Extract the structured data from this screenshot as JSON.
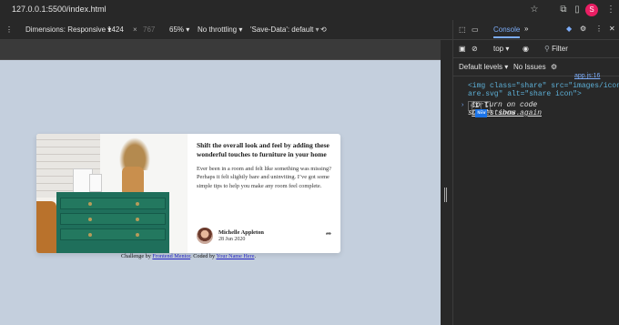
{
  "browser": {
    "url": "127.0.0.1:5500/index.html",
    "avatar_letter": "S"
  },
  "devbar": {
    "dimensions": "Dimensions: Responsive",
    "width": "1424",
    "times": "×",
    "height": "767",
    "zoom": "65%",
    "throttle": "No throttling",
    "save_data": "'Save-Data': default"
  },
  "card": {
    "title": "Shift the overall look and feel by adding these wonderful touches to furniture in your home",
    "description": "Ever been in a room and felt like something was missing? Perhaps it felt slightly bare and uninviting. I’ve got some simple tips to help you make any room feel complete.",
    "author": "Michelle Appleton",
    "date": "28 Jun 2020"
  },
  "attribution": {
    "prefix": "Challenge by",
    "fm": "Frontend Mentor",
    "mid": ". Coded by",
    "you": "Your Name Here",
    "end": "."
  },
  "devtools": {
    "tab_console": "Console",
    "top": "top",
    "filter": "Filter",
    "levels": "Default levels",
    "issues": "No Issues",
    "source": "app.js:16",
    "line1a": "<img class=\"share\" src=\"images/icon-sh",
    "line1b": "are.svg\" alt=\"share icon\">",
    "ctrl": "ctrl",
    "i": "i",
    "hint": " to turn on code",
    "hint2": "suggestions.",
    "dont": "Don't show again",
    "badge": "NEW"
  }
}
